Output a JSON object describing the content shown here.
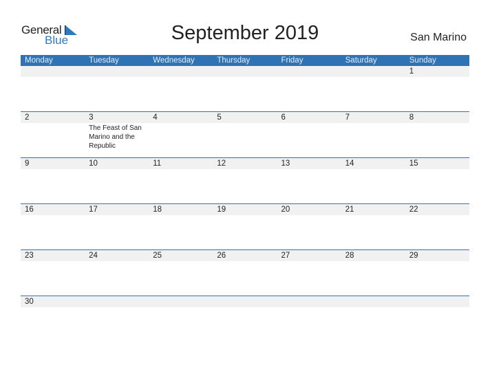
{
  "logo": {
    "word1": "General",
    "word2": "Blue"
  },
  "title": "September 2019",
  "country": "San Marino",
  "colors": {
    "accent": "#2f73b4",
    "strip": "#f1f1f1"
  },
  "weekdays": [
    "Monday",
    "Tuesday",
    "Wednesday",
    "Thursday",
    "Friday",
    "Saturday",
    "Sunday"
  ],
  "weeks": [
    {
      "days": [
        "",
        "",
        "",
        "",
        "",
        "",
        "1"
      ],
      "events": [
        "",
        "",
        "",
        "",
        "",
        "",
        ""
      ]
    },
    {
      "days": [
        "2",
        "3",
        "4",
        "5",
        "6",
        "7",
        "8"
      ],
      "events": [
        "",
        "The Feast of San Marino and the Republic",
        "",
        "",
        "",
        "",
        ""
      ]
    },
    {
      "days": [
        "9",
        "10",
        "11",
        "12",
        "13",
        "14",
        "15"
      ],
      "events": [
        "",
        "",
        "",
        "",
        "",
        "",
        ""
      ]
    },
    {
      "days": [
        "16",
        "17",
        "18",
        "19",
        "20",
        "21",
        "22"
      ],
      "events": [
        "",
        "",
        "",
        "",
        "",
        "",
        ""
      ]
    },
    {
      "days": [
        "23",
        "24",
        "25",
        "26",
        "27",
        "28",
        "29"
      ],
      "events": [
        "",
        "",
        "",
        "",
        "",
        "",
        ""
      ]
    },
    {
      "days": [
        "30",
        "",
        "",
        "",
        "",
        "",
        ""
      ],
      "events": [
        "",
        "",
        "",
        "",
        "",
        "",
        ""
      ]
    }
  ]
}
